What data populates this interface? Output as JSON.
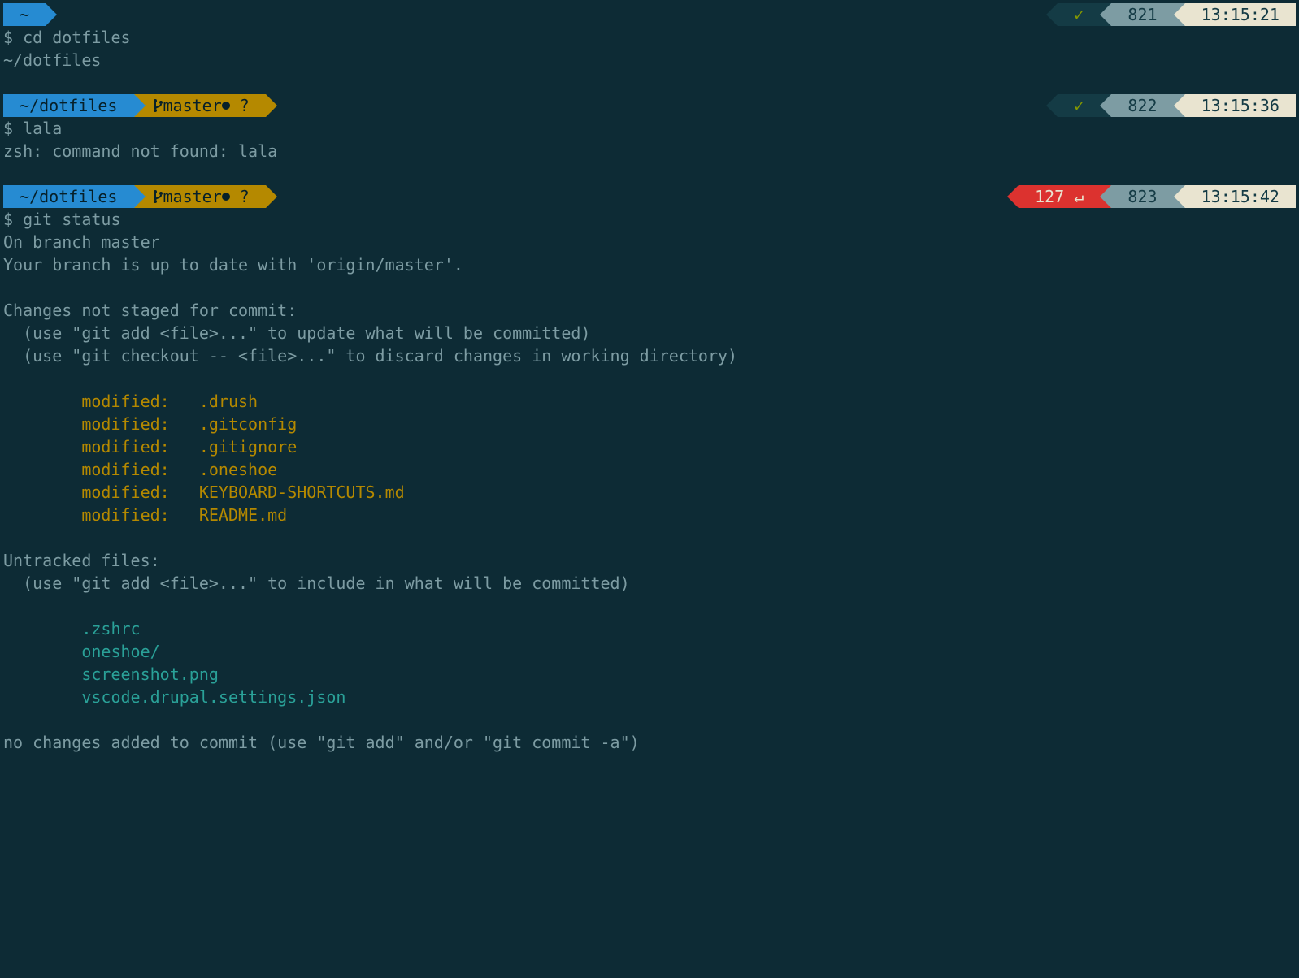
{
  "blocks": [
    {
      "left": {
        "path": "~",
        "git": null
      },
      "right": {
        "exit": null,
        "hist": "821",
        "time": "13:15:21",
        "checkmark": "✓"
      },
      "command": "cd dotfiles",
      "output": [
        {
          "text": "~/dotfiles",
          "cls": ""
        }
      ]
    },
    {
      "left": {
        "path": "~/dotfiles",
        "git": {
          "branch": "master",
          "flags": "● ?"
        }
      },
      "right": {
        "exit": null,
        "hist": "822",
        "time": "13:15:36",
        "checkmark": "✓"
      },
      "command": "lala",
      "output": [
        {
          "text": "zsh: command not found: lala",
          "cls": ""
        }
      ]
    },
    {
      "left": {
        "path": "~/dotfiles",
        "git": {
          "branch": "master",
          "flags": "● ?"
        }
      },
      "right": {
        "exit": {
          "code": "127",
          "sym": "↵"
        },
        "hist": "823",
        "time": "13:15:42",
        "checkmark": null
      },
      "command": "git status",
      "output": [
        {
          "text": "On branch master",
          "cls": ""
        },
        {
          "text": "Your branch is up to date with 'origin/master'.",
          "cls": ""
        },
        {
          "text": "",
          "cls": ""
        },
        {
          "text": "Changes not staged for commit:",
          "cls": ""
        },
        {
          "text": "  (use \"git add <file>...\" to update what will be committed)",
          "cls": ""
        },
        {
          "text": "  (use \"git checkout -- <file>...\" to discard changes in working directory)",
          "cls": ""
        },
        {
          "text": "",
          "cls": ""
        },
        {
          "text": "        modified:   .drush",
          "cls": "yellow-txt"
        },
        {
          "text": "        modified:   .gitconfig",
          "cls": "yellow-txt"
        },
        {
          "text": "        modified:   .gitignore",
          "cls": "yellow-txt"
        },
        {
          "text": "        modified:   .oneshoe",
          "cls": "yellow-txt"
        },
        {
          "text": "        modified:   KEYBOARD-SHORTCUTS.md",
          "cls": "yellow-txt"
        },
        {
          "text": "        modified:   README.md",
          "cls": "yellow-txt"
        },
        {
          "text": "",
          "cls": ""
        },
        {
          "text": "Untracked files:",
          "cls": ""
        },
        {
          "text": "  (use \"git add <file>...\" to include in what will be committed)",
          "cls": ""
        },
        {
          "text": "",
          "cls": ""
        },
        {
          "text": "        .zshrc",
          "cls": "teal-txt"
        },
        {
          "text": "        oneshoe/",
          "cls": "teal-txt"
        },
        {
          "text": "        screenshot.png",
          "cls": "teal-txt"
        },
        {
          "text": "        vscode.drupal.settings.json",
          "cls": "teal-txt"
        },
        {
          "text": "",
          "cls": ""
        },
        {
          "text": "no changes added to commit (use \"git add\" and/or \"git commit -a\")",
          "cls": ""
        }
      ]
    }
  ],
  "prompt_symbol": "$"
}
